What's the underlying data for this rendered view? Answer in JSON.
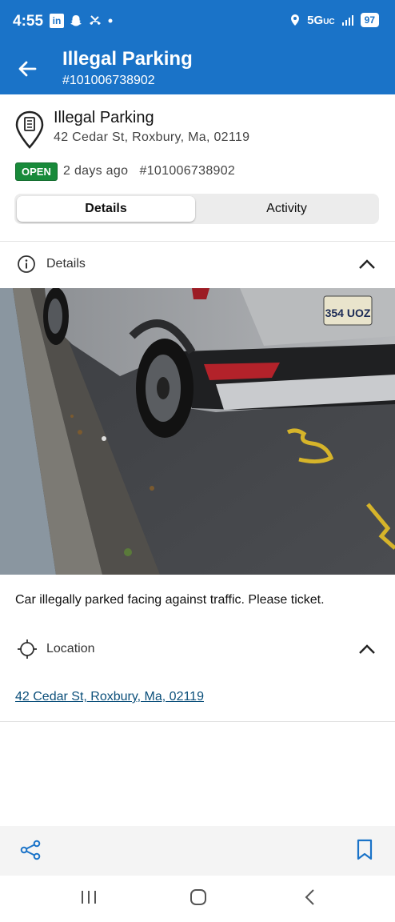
{
  "status_bar": {
    "time": "4:55",
    "linkedin": "in",
    "network": "5G",
    "network_sub": "UC",
    "battery": "97"
  },
  "app_bar": {
    "title": "Illegal Parking",
    "subtitle": "#101006738902"
  },
  "request": {
    "title": "Illegal Parking",
    "address": "42 Cedar St, Roxbury, Ma, 02119",
    "status": "OPEN",
    "age": "2 days ago",
    "id": "#101006738902",
    "status_color": "#188a3a"
  },
  "tabs": [
    {
      "label": "Details",
      "active": true
    },
    {
      "label": "Activity",
      "active": false
    }
  ],
  "details_section": {
    "label": "Details",
    "description": "Car illegally parked facing against traffic. Please ticket.",
    "plate_text": "354 UOZ"
  },
  "location_section": {
    "label": "Location",
    "link": "42 Cedar St, Roxbury, Ma, 02119"
  },
  "icons": {
    "share": "share-icon",
    "bookmark": "bookmark-icon",
    "info": "info-icon",
    "crosshair": "crosshair-icon",
    "pin": "map-pin-icon"
  },
  "colors": {
    "primary": "#1a73c8",
    "link": "#0b4f7a",
    "open_badge": "#188a3a"
  }
}
